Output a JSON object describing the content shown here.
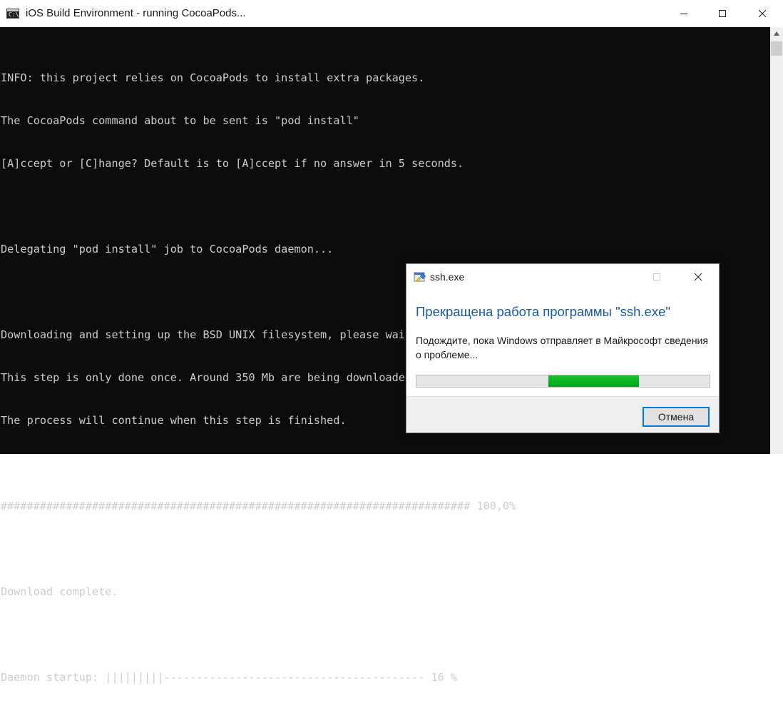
{
  "console_window": {
    "title": "iOS Build Environment - running CocoaPods...",
    "icon": "console-icon",
    "icon_glyph": "C:\\_",
    "controls": [
      "minimize-icon",
      "maximize-icon",
      "close-icon"
    ],
    "lines": [
      "INFO: this project relies on CocoaPods to install extra packages.",
      "The CocoaPods command about to be sent is \"pod install\"",
      "[A]ccept or [C]hange? Default is to [A]ccept if no answer in 5 seconds.",
      "",
      "Delegating \"pod install\" job to CocoaPods daemon...",
      "",
      "Downloading and setting up the BSD UNIX filesystem, please wait...",
      "This step is only done once. Around 350 Mb are being downloaded.",
      "The process will continue when this step is finished.",
      "",
      "######################################################################## 100,0%",
      "",
      "Download complete.",
      "",
      "Daemon startup: |||||||||---------------------------------------- 16 %"
    ],
    "colors": {
      "background": "#0c0c0c",
      "text": "#cccccc",
      "titlebar": "#ffffff"
    }
  },
  "error_dialog": {
    "title": "ssh.exe",
    "icon": "ssh-exe-icon",
    "heading": "Прекращена работа программы \"ssh.exe\"",
    "message": "Подождите, пока Windows отправляет в Майкрософт сведения о проблеме...",
    "progress": {
      "style": "marquee",
      "segment_start_fraction": 0.449,
      "segment_end_fraction": 0.757,
      "color": "#06b025"
    },
    "cancel_label": "Отмена",
    "controls": [
      "maximize-icon",
      "close-icon"
    ],
    "colors": {
      "heading": "#1c5ca5",
      "button_border": "#0078d7"
    }
  }
}
